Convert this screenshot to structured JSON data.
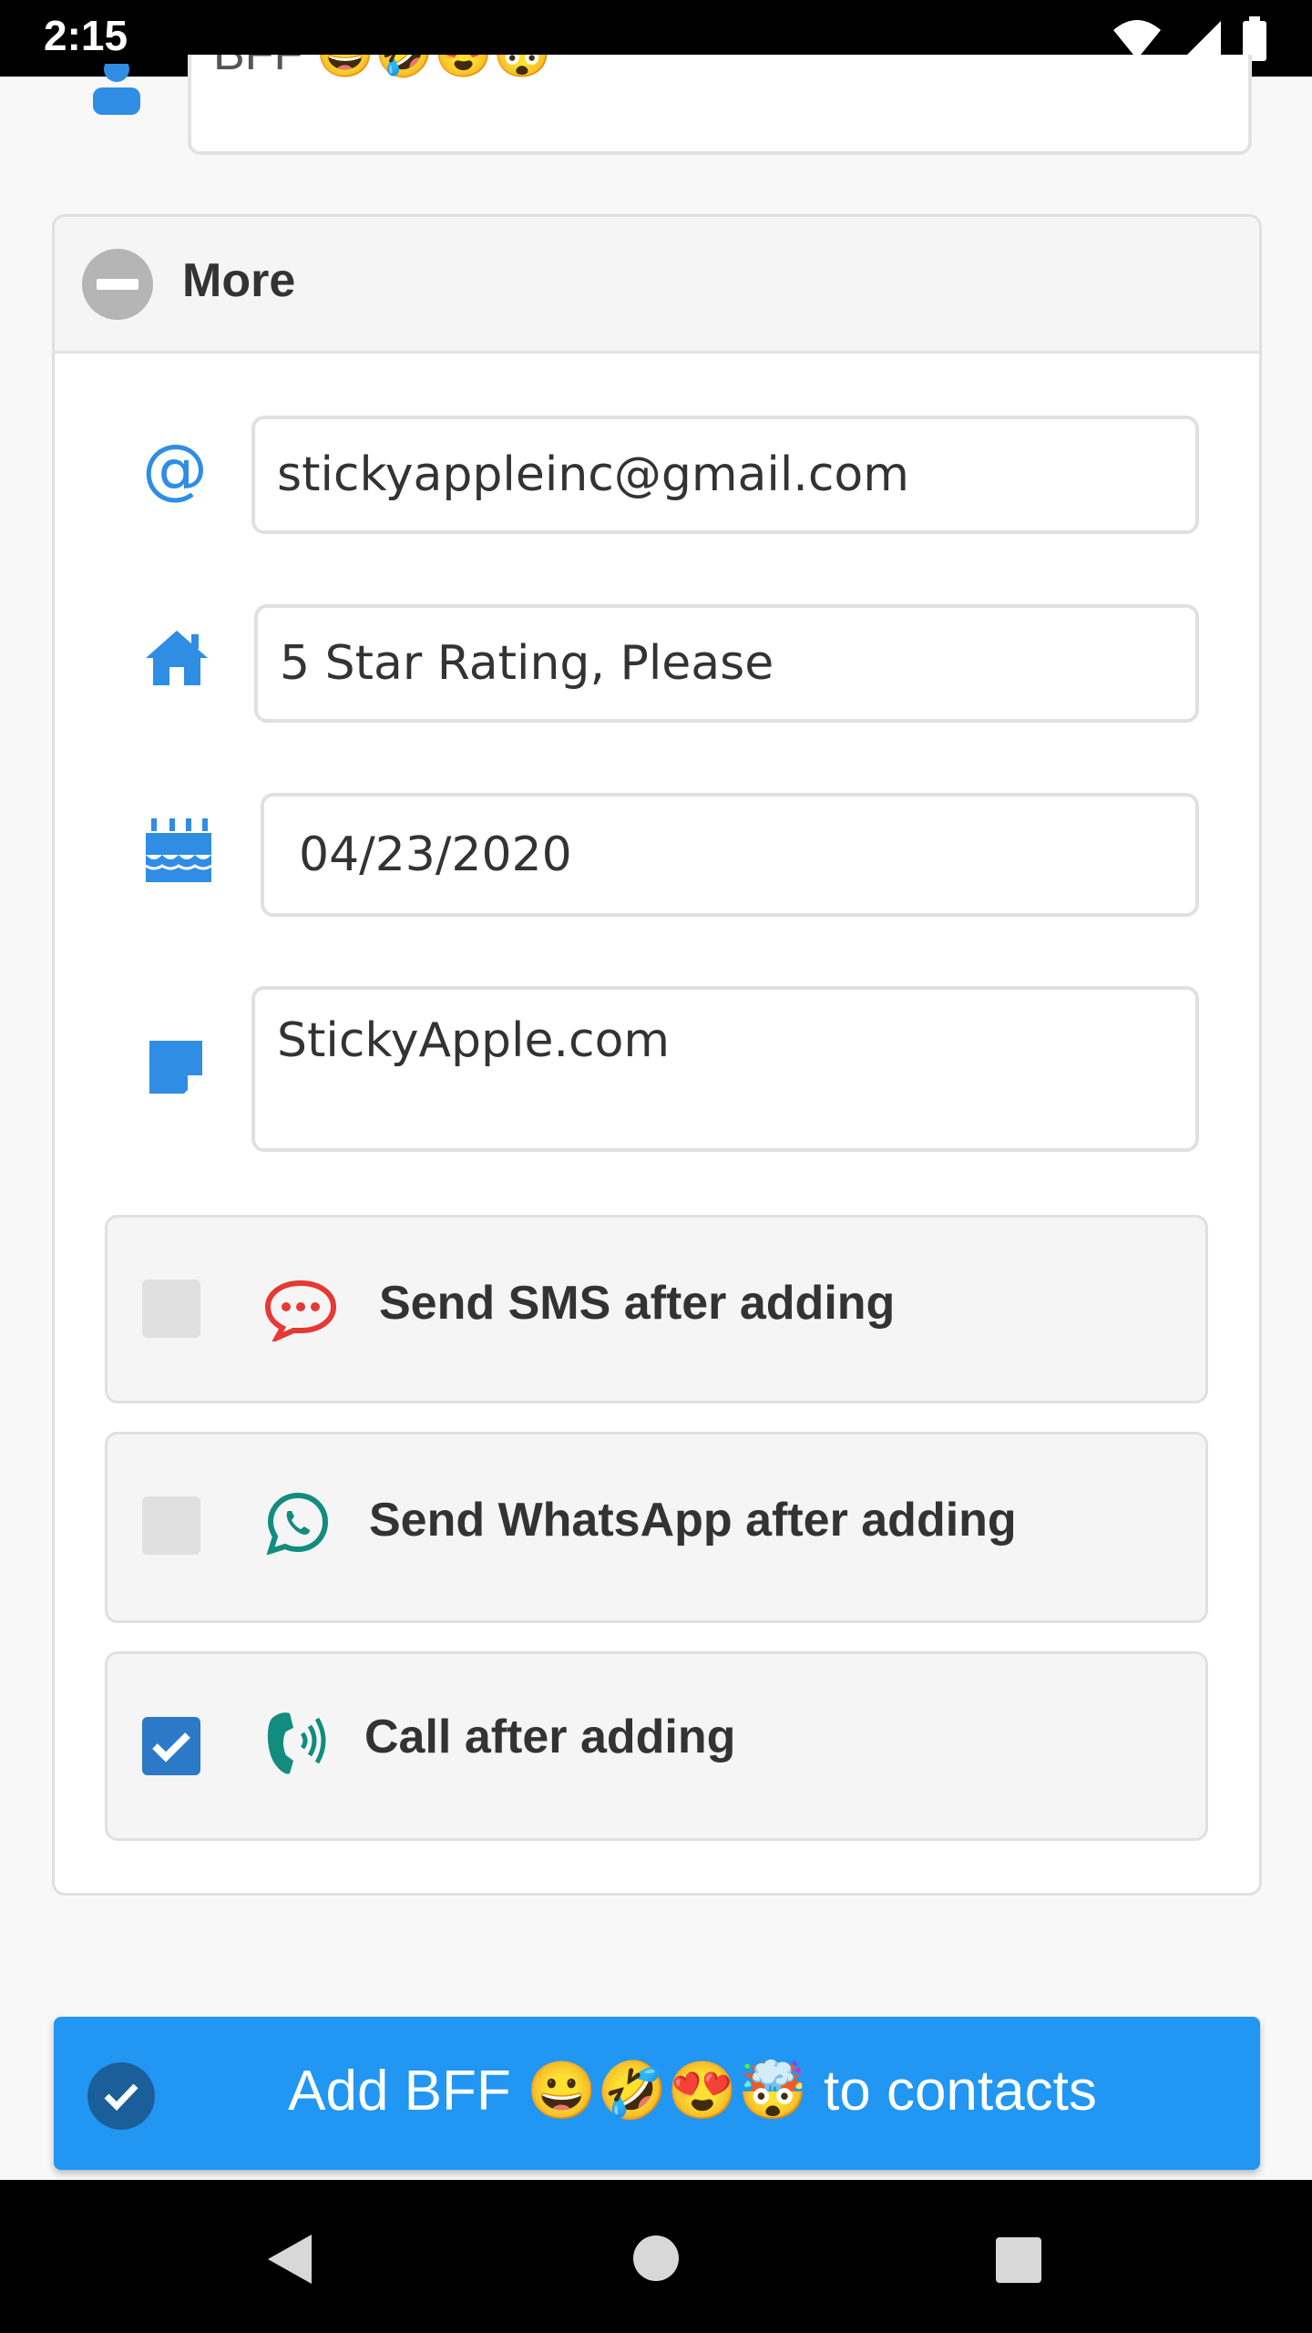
{
  "status_bar": {
    "time": "2:15"
  },
  "name_field": {
    "value": "BFF 😀🤣😍🤯"
  },
  "more_section": {
    "title": "More"
  },
  "fields": {
    "email": {
      "value": "stickyappleinc@gmail.com",
      "icon": "at-icon"
    },
    "address": {
      "value": "5 Star Rating, Please",
      "icon": "home-icon"
    },
    "birthday": {
      "value": "04/23/2020",
      "icon": "birthday-cake-icon"
    },
    "notes": {
      "value": "StickyApple.com",
      "icon": "note-icon"
    }
  },
  "options": {
    "sms": {
      "label": "Send SMS after adding",
      "checked": false,
      "icon": "sms-bubble-icon",
      "color": "#e53935"
    },
    "whatsapp": {
      "label": "Send WhatsApp after adding",
      "checked": false,
      "icon": "whatsapp-icon",
      "color": "#128c7e"
    },
    "call": {
      "label": "Call after adding",
      "checked": true,
      "icon": "phone-call-icon",
      "color": "#128c7e"
    }
  },
  "add_button": {
    "label": "Add BFF 😀🤣😍🤯 to contacts"
  },
  "colors": {
    "accent": "#2196f3",
    "icon_blue": "#2f8de4",
    "check_blue": "#2c79c8"
  }
}
